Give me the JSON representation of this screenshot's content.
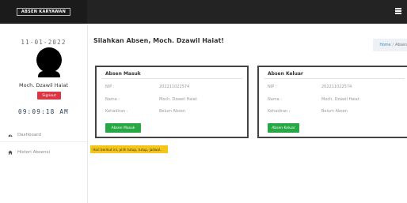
{
  "topbar": {
    "brand": "ABSEN KARYAWAN"
  },
  "sidebar": {
    "date": "11-01-2022",
    "user_name": "Moch. Dzawil Haiat",
    "signout_label": "Signout",
    "clock": "09:09:18 AM",
    "nav": [
      {
        "label": "Dashboard",
        "icon": "dashboard-icon"
      },
      {
        "label": "Histori Absensi",
        "icon": "home-icon"
      }
    ]
  },
  "main": {
    "title": "Silahkan Absen, Moch. Dzawil Haiat!",
    "breadcrumb": {
      "home": "Home",
      "current": "Absen"
    }
  },
  "cards": [
    {
      "title": "Absen Masuk",
      "rows": [
        {
          "label": "NIP :",
          "value": "202211022574"
        },
        {
          "label": "Nama :",
          "value": "Moch. Dzawil Haiat"
        },
        {
          "label": "Kehadiran :",
          "value": "Belum Absen"
        }
      ],
      "button": "Absen Masuk",
      "button_color": "#28a745"
    },
    {
      "title": "Absen Keluar",
      "rows": [
        {
          "label": "NIP :",
          "value": "202211022574"
        },
        {
          "label": "Nama :",
          "value": "Moch. Dzawil Haiat"
        },
        {
          "label": "Kehadiran :",
          "value": "Belum Absen"
        }
      ],
      "button": "Absen Keluar",
      "button_color": "#28a745"
    }
  ],
  "alert": "Hari berikut ini, pilih tutup, tutup, jadwal..",
  "colors": {
    "topbar": "#232323",
    "signout": "#dc3545",
    "success": "#28a745",
    "warning": "#f5c518",
    "link": "#3c8dbc"
  }
}
